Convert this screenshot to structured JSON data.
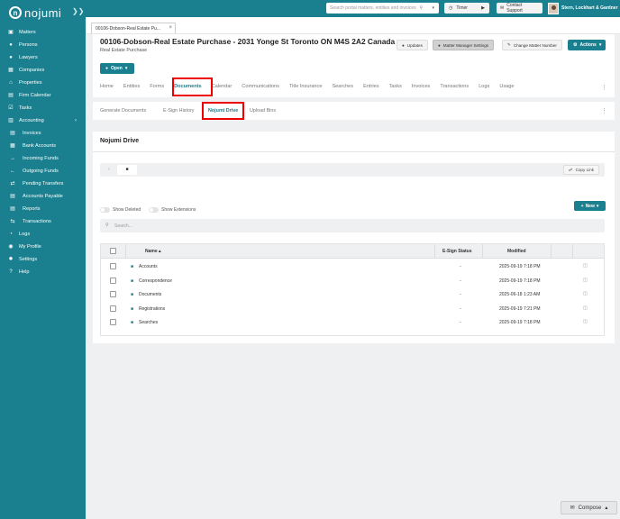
{
  "app": {
    "logo_text": "nojumi"
  },
  "sidebar": {
    "items": [
      {
        "label": "Matters",
        "icon": "briefcase-icon",
        "glyph": "▣"
      },
      {
        "label": "Persons",
        "icon": "persons-icon",
        "glyph": "●"
      },
      {
        "label": "Lawyers",
        "icon": "lawyer-icon",
        "glyph": "●"
      },
      {
        "label": "Companies",
        "icon": "building-icon",
        "glyph": "▦"
      },
      {
        "label": "Properties",
        "icon": "home-icon",
        "glyph": "⌂"
      },
      {
        "label": "Firm Calendar",
        "icon": "calendar-icon",
        "glyph": "▤"
      },
      {
        "label": "Tasks",
        "icon": "tasks-icon",
        "glyph": "☑"
      },
      {
        "label": "Accounting",
        "icon": "accounting-icon",
        "glyph": "▥"
      }
    ],
    "sub_items": [
      {
        "label": "Invoices",
        "icon": "invoice-icon",
        "glyph": "▤"
      },
      {
        "label": "Bank Accounts",
        "icon": "bank-icon",
        "glyph": "▦"
      },
      {
        "label": "Incoming Funds",
        "icon": "incoming-arrow-icon",
        "glyph": "→"
      },
      {
        "label": "Outgoing Funds",
        "icon": "outgoing-arrow-icon",
        "glyph": "←"
      },
      {
        "label": "Pending Transfers",
        "icon": "transfer-icon",
        "glyph": "⇄"
      },
      {
        "label": "Accounts Payable",
        "icon": "payable-icon",
        "glyph": "▤"
      },
      {
        "label": "Reports",
        "icon": "reports-icon",
        "glyph": "▤"
      },
      {
        "label": "Transactions",
        "icon": "transactions-icon",
        "glyph": "⇆"
      }
    ],
    "bottom_items": [
      {
        "label": "Logs",
        "icon": "logs-icon",
        "glyph": "◔"
      },
      {
        "label": "My Profile",
        "icon": "profile-icon",
        "glyph": "◉"
      },
      {
        "label": "Settings",
        "icon": "gear-icon",
        "glyph": "✹"
      },
      {
        "label": "Help",
        "icon": "help-icon",
        "glyph": "?"
      }
    ]
  },
  "topbar": {
    "search_placeholder": "Search portal matters, entities and invoices",
    "timer_label": "Timer",
    "contact_label": "Contact Support",
    "firm_name": "Stern, Lockhart & Gardner"
  },
  "open_tab": {
    "label": "00106-Dobson-Real Estate Pu..."
  },
  "matter": {
    "title": "00106-Dobson-Real Estate Purchase - 2031 Yonge St Toronto ON M4S 2A2 Canada",
    "subtitle": "Real Estate Purchase",
    "updates_label": "Updates",
    "manager_label": "Matter Manager Settings",
    "change_number_label": "Change Matter Number",
    "actions_label": "Actions",
    "open_label": "Open",
    "tabs": [
      "Home",
      "Entities",
      "Forms",
      "Documents",
      "Calendar",
      "Communications",
      "Title Insurance",
      "Searches",
      "Entries",
      "Tasks",
      "Invoices",
      "Transactions",
      "Logs",
      "Usage"
    ],
    "active_tab": "Documents"
  },
  "doc_tabs": {
    "items": [
      "Generate Documents",
      "E-Sign History",
      "Nojumi Drive",
      "Upload Bins"
    ],
    "active": "Nojumi Drive"
  },
  "drive": {
    "title": "Nojumi Drive",
    "copy_link_label": "Copy Link",
    "new_label": "New",
    "show_deleted_label": "Show Deleted",
    "show_extensions_label": "Show Extensions",
    "search_placeholder": "Search...",
    "columns": {
      "name": "Name",
      "esign": "E-Sign Status",
      "modified": "Modified"
    },
    "rows": [
      {
        "name": "Accounts",
        "esign": "-",
        "modified": "2025-09-19 7:18 PM"
      },
      {
        "name": "Correspondence",
        "esign": "-",
        "modified": "2025-09-19 7:18 PM"
      },
      {
        "name": "Documents",
        "esign": "-",
        "modified": "2025-06-18 1:23 AM"
      },
      {
        "name": "Registrations",
        "esign": "-",
        "modified": "2025-09-19 7:21 PM"
      },
      {
        "name": "Searches",
        "esign": "-",
        "modified": "2025-09-19 7:18 PM"
      }
    ]
  },
  "compose": {
    "label": "Compose"
  },
  "colors": {
    "brand": "#1a7f8e",
    "highlight": "#e00000"
  }
}
